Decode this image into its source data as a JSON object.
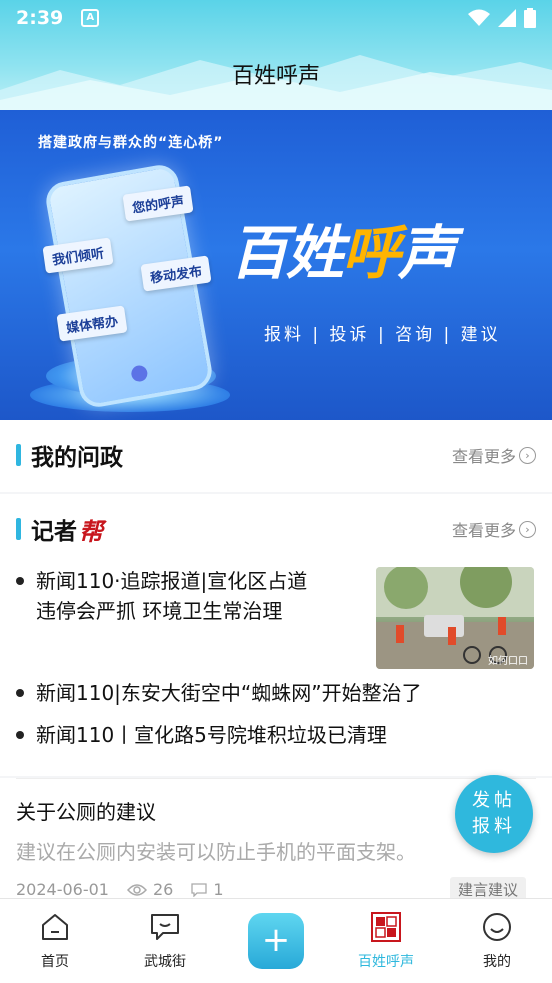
{
  "status_bar": {
    "time": "2:39",
    "notification_icon": "a-icon"
  },
  "header": {
    "title": "百姓呼声"
  },
  "banner": {
    "slogan": "搭建政府与群众的“连心桥”",
    "bubbles": [
      "您的呼声",
      "我们倾听",
      "移动发布",
      "媒体帮办"
    ],
    "big_title_a": "百姓",
    "big_title_b": "呼",
    "big_title_c": "声",
    "actions": "报料 | 投诉 | 咨询 | 建议"
  },
  "section_my": {
    "title": "我的问政",
    "more": "查看更多"
  },
  "section_reporter": {
    "title": "记者",
    "title_mark": "帮",
    "more": "查看更多",
    "news": [
      {
        "line1": "新闻110·追踪报道|宣化区占道",
        "line2": "违停会严抓 环境卫生常治理"
      },
      {
        "line1": "新闻110|东安大街空中“蜘蛛网”开始整治了"
      },
      {
        "line1": "新闻110丨宣化路5号院堆积垃圾已清理"
      }
    ],
    "thumb_caption": "如何口口"
  },
  "post": {
    "title": "关于公厕的建议",
    "body": "建议在公厕内安装可以防止手机的平面支架。",
    "date": "2024-06-01",
    "views": "26",
    "comments": "1",
    "tag": "建言建议"
  },
  "fab": {
    "line1": "发帖",
    "line2": "报料"
  },
  "tabs": [
    {
      "label": "首页",
      "icon": "home-icon",
      "active": false
    },
    {
      "label": "武城街",
      "icon": "chat-icon",
      "active": false
    },
    {
      "label": "",
      "icon": "plus-icon",
      "active": false
    },
    {
      "label": "百姓呼声",
      "icon": "baixing-logo-icon",
      "active": true
    },
    {
      "label": "我的",
      "icon": "smile-icon",
      "active": false
    }
  ],
  "colors": {
    "accent": "#2fb8dd",
    "active_tab": "#2fb8dd",
    "brand_red": "#c8161d"
  }
}
